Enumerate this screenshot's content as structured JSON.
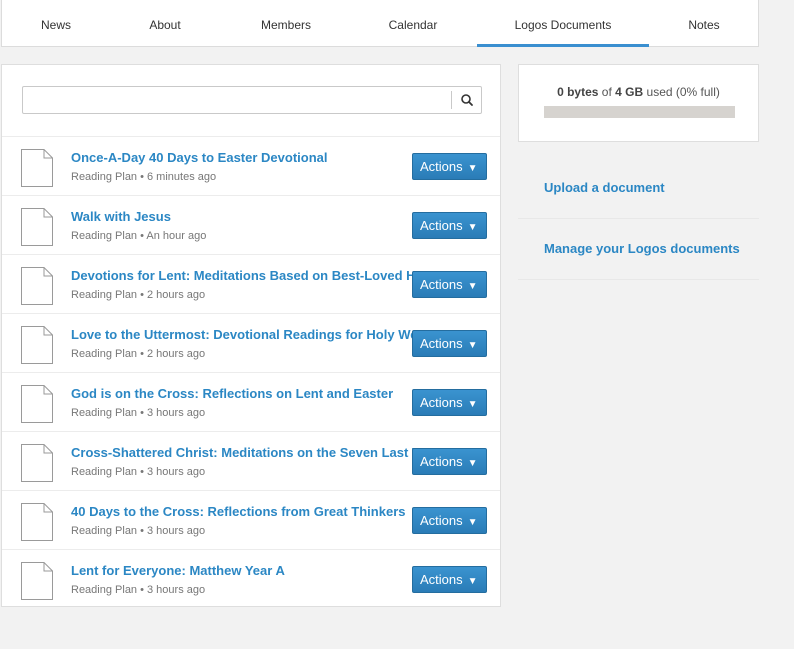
{
  "tabs": [
    {
      "label": "News"
    },
    {
      "label": "About"
    },
    {
      "label": "Members"
    },
    {
      "label": "Calendar"
    },
    {
      "label": "Logos Documents",
      "active": true
    },
    {
      "label": "Notes"
    }
  ],
  "search": {
    "value": "",
    "placeholder": "",
    "icon": "search-icon"
  },
  "documents": [
    {
      "title": "Once-A-Day 40 Days to Easter Devotional",
      "meta": "Reading Plan • 6 minutes ago",
      "action": "Actions"
    },
    {
      "title": "Walk with Jesus",
      "meta": "Reading Plan • An hour ago",
      "action": "Actions"
    },
    {
      "title": "Devotions for Lent: Meditations Based on Best-Loved Hymns",
      "meta": "Reading Plan • 2 hours ago",
      "action": "Actions"
    },
    {
      "title": "Love to the Uttermost: Devotional Readings for Holy Week",
      "meta": "Reading Plan • 2 hours ago",
      "action": "Actions"
    },
    {
      "title": "God is on the Cross: Reflections on Lent and Easter",
      "meta": "Reading Plan • 3 hours ago",
      "action": "Actions"
    },
    {
      "title": "Cross-Shattered Christ: Meditations on the Seven Last Words",
      "meta": "Reading Plan • 3 hours ago",
      "action": "Actions"
    },
    {
      "title": "40 Days to the Cross: Reflections from Great Thinkers",
      "meta": "Reading Plan • 3 hours ago",
      "action": "Actions"
    },
    {
      "title": "Lent for Everyone: Matthew Year A",
      "meta": "Reading Plan • 3 hours ago",
      "action": "Actions"
    }
  ],
  "storage": {
    "used": "0 bytes",
    "of": "of",
    "total": "4 GB",
    "suffix": "used (0% full)",
    "fraction_full": 0
  },
  "sidebar": {
    "upload_label": "Upload a document",
    "manage_label": "Manage your Logos documents"
  },
  "colors": {
    "accent": "#2b87c4",
    "tab_underline": "#3a8fd0",
    "bar_track": "#d6d3cf"
  }
}
